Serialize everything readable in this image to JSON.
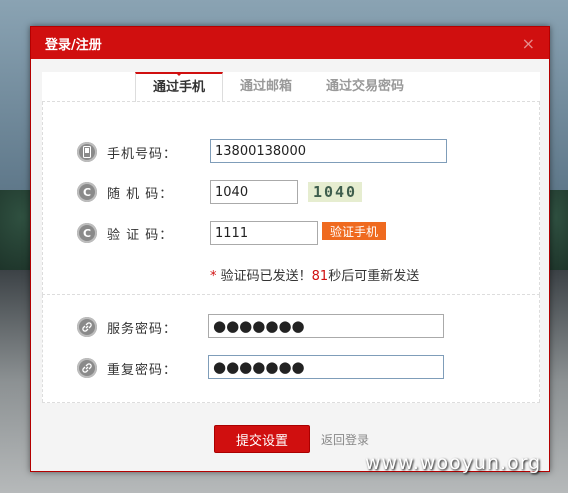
{
  "dialog": {
    "title": "登录/注册",
    "close_icon": "×"
  },
  "tabs": [
    {
      "label": "通过手机",
      "active": true
    },
    {
      "label": "通过邮箱",
      "active": false
    },
    {
      "label": "通过交易密码",
      "active": false
    }
  ],
  "form": {
    "phone": {
      "label": "手机号码：",
      "value": "13800138000",
      "icon": "phone-icon"
    },
    "random": {
      "label": "随 机 码：",
      "value": "1040",
      "captcha": "1040",
      "icon": "c-icon"
    },
    "verify": {
      "label": "验 证 码：",
      "value": "1111",
      "button": "验证手机",
      "icon": "c-icon"
    },
    "notice": {
      "star": "*",
      "before": " 验证码已发送！",
      "count": "81",
      "after": "秒后可重新发送"
    },
    "service_pw": {
      "label": "服务密码：",
      "value": "●●●●●●●",
      "icon": "link-icon"
    },
    "repeat_pw": {
      "label": "重复密码：",
      "value": "●●●●●●●",
      "icon": "link-icon"
    }
  },
  "footer": {
    "submit": "提交设置",
    "back": "返回登录"
  },
  "watermark": "www.wooyun.org"
}
